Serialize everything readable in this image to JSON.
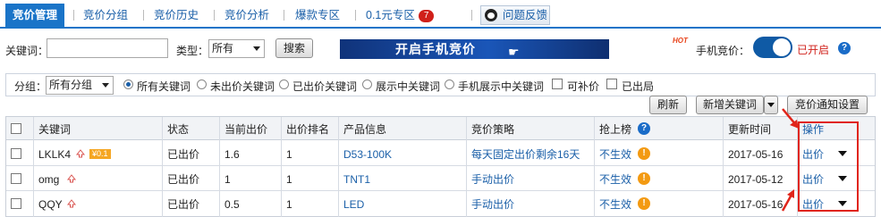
{
  "nav": {
    "tabs": [
      {
        "label": "竞价管理",
        "active": true
      },
      {
        "label": "竞价分组"
      },
      {
        "label": "竞价历史"
      },
      {
        "label": "竞价分析"
      },
      {
        "label": "爆款专区"
      },
      {
        "label": "0.1元专区"
      }
    ],
    "badge": "7",
    "feedback_label": "问题反馈"
  },
  "search": {
    "keyword_label": "关键词：",
    "keyword_value": "",
    "type_label": "类型：",
    "type_value": "所有",
    "search_button": "搜索",
    "banner_text": "开启手机竞价",
    "hot_label": "HOT",
    "mobile_label": "手机竞价：",
    "mobile_status": "已开启"
  },
  "filter": {
    "group_label": "分组：",
    "group_value": "所有分组",
    "radios": [
      "所有关键词",
      "未出价关键词",
      "已出价关键词",
      "展示中关键词",
      "手机展示中关键词"
    ],
    "checks": [
      "可补价",
      "已出局"
    ]
  },
  "actions": {
    "refresh": "刷新",
    "add_keyword": "新增关键词",
    "notify_settings": "竞价通知设置"
  },
  "table": {
    "headers": [
      "关键词",
      "状态",
      "当前出价",
      "出价排名",
      "产品信息",
      "竞价策略",
      "抢上榜",
      "更新时间",
      "操作"
    ],
    "rows": [
      {
        "keyword": "LKLK4",
        "tag": "¥0.1",
        "status": "已出价",
        "bid": "1.6",
        "rank": "1",
        "product": "D53-100K",
        "strategy": "每天固定出价剩余16天",
        "rush": "不生效",
        "updated": "2017-05-16",
        "op": "出价"
      },
      {
        "keyword": "omg",
        "tag": "",
        "status": "已出价",
        "bid": "1",
        "rank": "1",
        "product": "TNT1",
        "strategy": "手动出价",
        "rush": "不生效",
        "updated": "2017-05-12",
        "op": "出价"
      },
      {
        "keyword": "QQY",
        "tag": "",
        "status": "已出价",
        "bid": "0.5",
        "rank": "1",
        "product": "LED",
        "strategy": "手动出价",
        "rush": "不生效",
        "updated": "2017-05-16",
        "op": "出价"
      }
    ]
  },
  "colors": {
    "accent": "#1a74c8",
    "link": "#1a5fa8",
    "highlight": "#e0251b",
    "warn": "#f39a12"
  }
}
